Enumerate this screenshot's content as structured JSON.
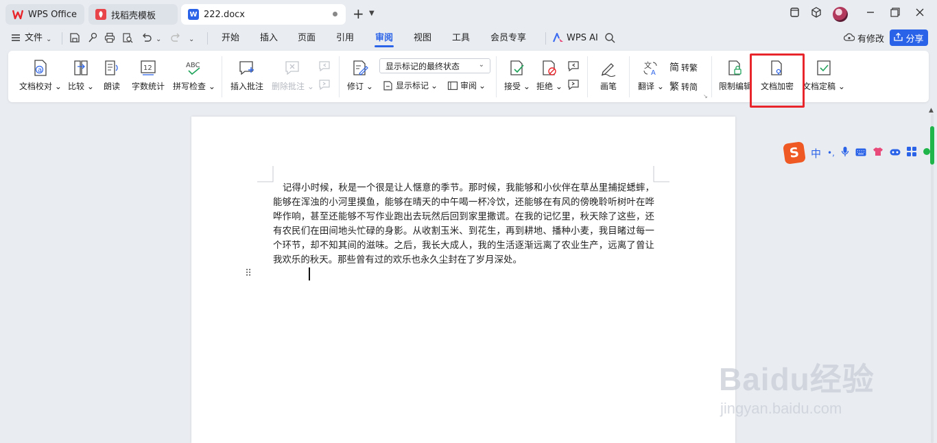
{
  "tabs": [
    {
      "label": "WPS Office"
    },
    {
      "label": "找稻壳模板"
    },
    {
      "label": "222.docx"
    }
  ],
  "menu": {
    "file": "文件",
    "items": [
      "开始",
      "插入",
      "页面",
      "引用",
      "审阅",
      "视图",
      "工具",
      "会员专享"
    ],
    "active": "审阅",
    "wps_ai": "WPS AI",
    "changes": "有修改",
    "share": "分享"
  },
  "ribbon": {
    "proofread": "文档校对",
    "compare": "比较",
    "read_aloud": "朗读",
    "word_count": "字数统计",
    "spell_check": "拼写检查",
    "insert_comment": "插入批注",
    "delete_comment": "删除批注",
    "track_changes": "修订",
    "markup_dropdown": "显示标记的最终状态",
    "show_markup": "显示标记",
    "review": "审阅",
    "accept": "接受",
    "reject": "拒绝",
    "pen": "画笔",
    "translate": "翻译",
    "to_traditional": "转繁",
    "to_simplified": "转简",
    "restrict_edit": "限制编辑",
    "encrypt": "文档加密",
    "finalize": "文档定稿",
    "spell_icon_text": "ABC",
    "count_icon_text": "12"
  },
  "document": {
    "paragraph": "记得小时候，秋是一个很是让人惬意的季节。那时候，我能够和小伙伴在草丛里捕捉蟋蟀，能够在浑浊的小河里摸鱼，能够在晴天的中午喝一杯冷饮，还能够在有风的傍晚聆听树叶在哗哗作响，甚至还能够不写作业跑出去玩然后回到家里撒谎。在我的记忆里，秋天除了这些，还有农民们在田间地头忙碌的身影。从收割玉米、到花生，再到耕地、播种小麦，我目睹过每一个环节，却不知其间的滋味。之后，我长大成人，我的生活逐渐远离了农业生产，远离了曾让我欢乐的秋天。那些曾有过的欢乐也永久尘封在了岁月深处。"
  },
  "ime": {
    "logo": "S",
    "mode": "中",
    "punct": "•,"
  },
  "watermark": {
    "brand": "Baidu经验",
    "url": "jingyan.baidu.com"
  },
  "colors": {
    "accent": "#2b63e8",
    "highlight": "#e8252a",
    "wps_red": "#e8252a",
    "scroll_thumb": "#1fb54a"
  }
}
